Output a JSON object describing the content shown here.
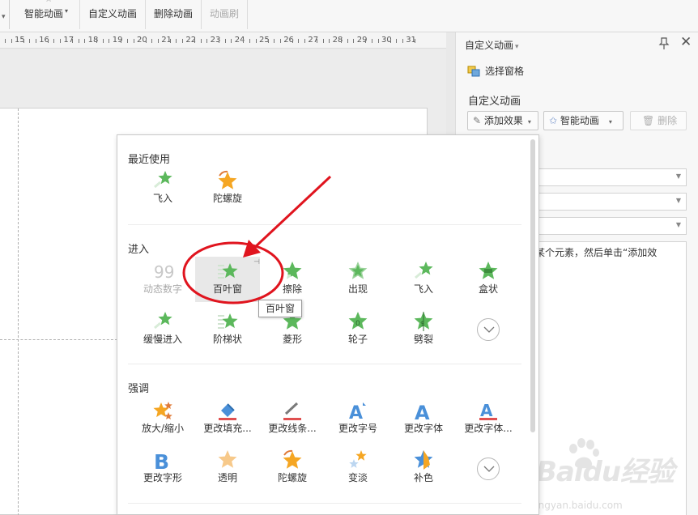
{
  "ribbon": {
    "smart_animation": "智能动画",
    "custom_animation": "自定义动画",
    "delete_animation": "删除动画",
    "animation_brush": "动画刷"
  },
  "ruler": {
    "labels": [
      "15",
      "16",
      "17",
      "18",
      "19",
      "20",
      "21",
      "22",
      "23",
      "24",
      "25",
      "26",
      "27",
      "28",
      "29",
      "30",
      "31"
    ]
  },
  "pane": {
    "title": "自定义动画",
    "select_pane": "选择窗格",
    "subtitle": "自定义动画",
    "add_effect": "添加效果",
    "smart_animation": "智能动画",
    "delete": "删除",
    "hint": "某个元素，然后单击“添加效"
  },
  "popup": {
    "recent": {
      "title": "最近使用",
      "items": [
        {
          "label": "飞入",
          "icon": "fly-in-star-icon"
        },
        {
          "label": "陀螺旋",
          "icon": "spin-star-icon"
        }
      ]
    },
    "entrance": {
      "title": "进入",
      "items": [
        {
          "label": "动态数字",
          "icon": "dynamic-number-icon",
          "disabled": true
        },
        {
          "label": "百叶窗",
          "icon": "blinds-star-icon",
          "selected": true
        },
        {
          "label": "擦除",
          "icon": "wipe-star-icon"
        },
        {
          "label": "出现",
          "icon": "appear-star-icon"
        },
        {
          "label": "飞入",
          "icon": "fly-in-star-icon"
        },
        {
          "label": "盒状",
          "icon": "box-star-icon"
        },
        {
          "label": "缓慢进入",
          "icon": "crawl-in-star-icon"
        },
        {
          "label": "阶梯状",
          "icon": "step-star-icon"
        },
        {
          "label": "菱形",
          "icon": "diamond-star-icon"
        },
        {
          "label": "轮子",
          "icon": "wheel-star-icon"
        },
        {
          "label": "劈裂",
          "icon": "split-star-icon"
        }
      ]
    },
    "emphasis": {
      "title": "强调",
      "items": [
        {
          "label": "放大/缩小",
          "icon": "grow-shrink-star-icon"
        },
        {
          "label": "更改填充...",
          "icon": "change-fill-icon"
        },
        {
          "label": "更改线条...",
          "icon": "change-line-icon"
        },
        {
          "label": "更改字号",
          "icon": "change-font-size-icon"
        },
        {
          "label": "更改字体",
          "icon": "change-font-icon"
        },
        {
          "label": "更改字体...",
          "icon": "change-font-color-icon"
        },
        {
          "label": "更改字形",
          "icon": "change-font-style-icon"
        },
        {
          "label": "透明",
          "icon": "transparency-star-icon"
        },
        {
          "label": "陀螺旋",
          "icon": "spin-star-icon"
        },
        {
          "label": "变淡",
          "icon": "fade-star-icon"
        },
        {
          "label": "补色",
          "icon": "complementary-color-star-icon"
        }
      ]
    },
    "tooltip": "百叶窗"
  },
  "watermark": {
    "brand": "Baidu经验",
    "url": "jingyan.baidu.com"
  },
  "colors": {
    "entrance_star": "#5cb85c",
    "emphasis_star": "#f5a623",
    "font_blue": "#4a90d9",
    "annotation_red": "#e0141e"
  }
}
